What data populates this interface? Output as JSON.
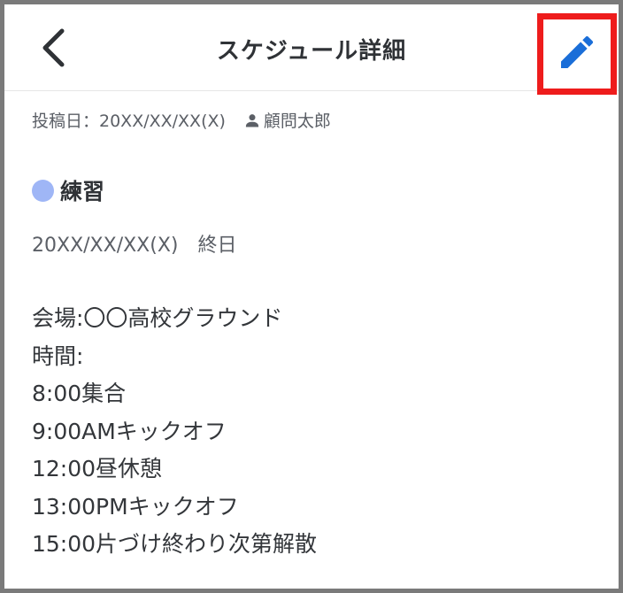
{
  "header": {
    "title": "スケジュール詳細",
    "back_icon": "chevron-left-icon",
    "edit_icon": "pencil-icon",
    "highlight_color": "#ee1c1c",
    "edit_icon_color": "#1a6ed8"
  },
  "post": {
    "posted_label": "投稿日：20XX/XX/XX(X)",
    "author_icon": "person-icon",
    "author": "顧問太郎"
  },
  "event": {
    "dot_color": "#9fb6f6",
    "title": "練習",
    "date": "20XX/XX/XX(X)",
    "all_day": "終日"
  },
  "details": {
    "lines": [
      "会場:〇〇高校グラウンド",
      "時間:",
      "8:00集合",
      "9:00AMキックオフ",
      "12:00昼休憩",
      "13:00PMキックオフ",
      "15:00片づけ終わり次第解散"
    ]
  }
}
